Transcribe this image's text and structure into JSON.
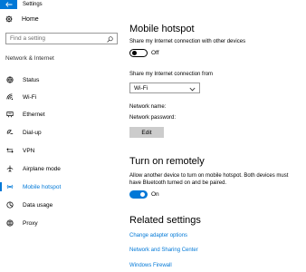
{
  "app": {
    "title": "Settings"
  },
  "sidebar": {
    "home_label": "Home",
    "search_placeholder": "Find a setting",
    "section_label": "Network & Internet",
    "items": [
      {
        "label": "Status",
        "icon": "globe-icon"
      },
      {
        "label": "Wi-Fi",
        "icon": "wifi-icon"
      },
      {
        "label": "Ethernet",
        "icon": "ethernet-icon"
      },
      {
        "label": "Dial-up",
        "icon": "dialup-icon"
      },
      {
        "label": "VPN",
        "icon": "vpn-icon"
      },
      {
        "label": "Airplane mode",
        "icon": "airplane-icon"
      },
      {
        "label": "Mobile hotspot",
        "icon": "hotspot-icon",
        "selected": true
      },
      {
        "label": "Data usage",
        "icon": "data-usage-icon"
      },
      {
        "label": "Proxy",
        "icon": "proxy-icon"
      }
    ]
  },
  "main": {
    "title": "Mobile hotspot",
    "share_label": "Share my Internet connection with other devices",
    "share_toggle": "Off",
    "share_from_label": "Share my Internet connection from",
    "share_from_value": "Wi-Fi",
    "network_name_label": "Network name:",
    "network_password_label": "Network password:",
    "edit_button": "Edit",
    "remote_title": "Turn on remotely",
    "remote_desc": "Allow another device to turn on mobile hotspot. Both devices must have Bluetooth turned on and be paired.",
    "remote_toggle": "On",
    "related_title": "Related settings",
    "links": [
      "Change adapter options",
      "Network and Sharing Center",
      "Windows Firewall"
    ]
  },
  "colors": {
    "accent": "#0078d7",
    "button": "#cccccc"
  }
}
